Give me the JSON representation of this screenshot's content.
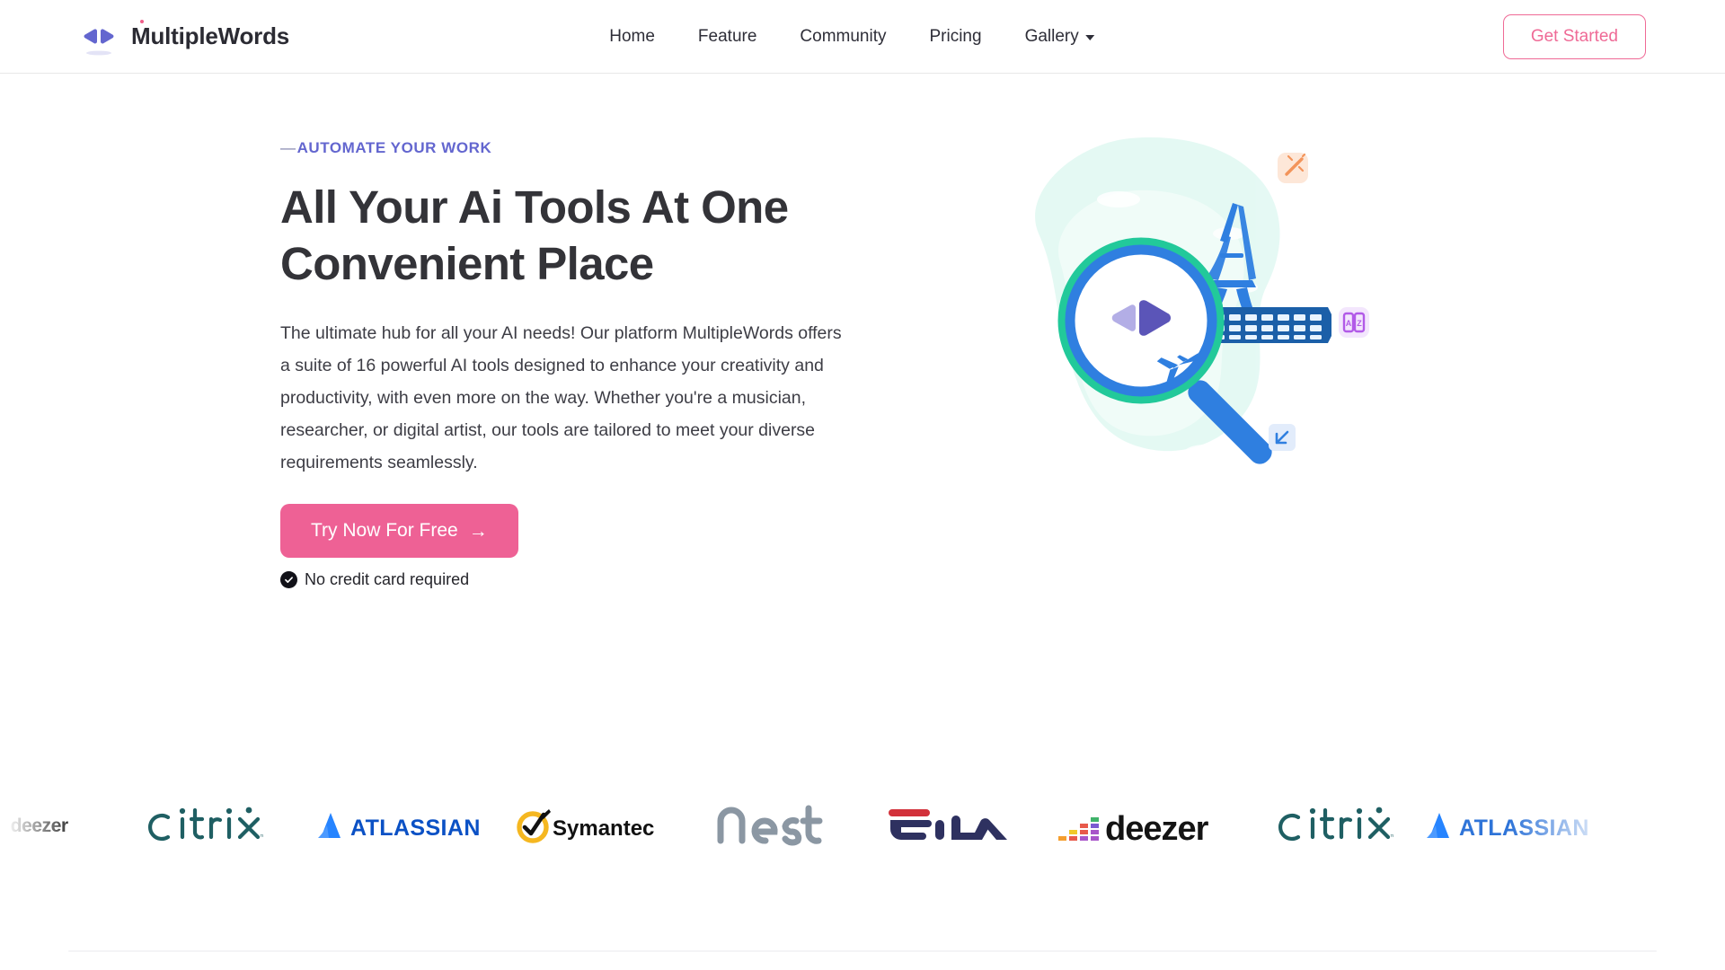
{
  "header": {
    "brand": {
      "name": "MultipleWords",
      "logo_icon": "bowtie-logo-icon",
      "color": "#6366cf"
    },
    "nav": [
      {
        "label": "Home",
        "has_dropdown": false
      },
      {
        "label": "Feature",
        "has_dropdown": false
      },
      {
        "label": "Community",
        "has_dropdown": false
      },
      {
        "label": "Pricing",
        "has_dropdown": false
      },
      {
        "label": "Gallery",
        "has_dropdown": true
      }
    ],
    "cta": {
      "label": "Get Started",
      "color": "#ef6a96"
    }
  },
  "hero": {
    "eyebrow_dash": "—",
    "eyebrow": "AUTOMATE YOUR WORK",
    "eyebrow_color": "#6366cf",
    "title": "All Your Ai Tools At One Convenient Place",
    "description": "The ultimate hub for all your AI needs! Our platform MultipleWords offers a suite of 16 powerful AI tools designed to enhance your creativity and productivity, with even more on the way. Whether you're a musician, researcher, or digital artist, our tools are tailored to meet your diverse requirements seamlessly.",
    "cta": {
      "label": "Try Now For Free",
      "arrow": "→",
      "color": "#ee6195"
    },
    "note": {
      "label": "No credit card required",
      "icon": "check-circle-icon"
    },
    "illustration": {
      "name": "magnifying-glass-travel-illustration",
      "lens_outer_color": "#22c99a",
      "lens_inner_color": "#2f7fe0",
      "blob_color": "#dcf7f0",
      "badges": [
        {
          "name": "magic-wand-badge",
          "bg": "#fde7d8",
          "fg": "#f3945a"
        },
        {
          "name": "translate-badge",
          "bg": "#f3e6fd",
          "fg": "#b25ae8"
        },
        {
          "name": "expand-badge",
          "bg": "#e2ecfb",
          "fg": "#2f7fe0"
        }
      ]
    }
  },
  "logos": [
    {
      "name": "deezer",
      "label": "deezer",
      "variant": "partial-left"
    },
    {
      "name": "citrix",
      "label": "citrix",
      "variant": "full"
    },
    {
      "name": "atlassian",
      "label": "ATLASSIAN",
      "variant": "full"
    },
    {
      "name": "symantec",
      "label": "Symantec",
      "variant": "full"
    },
    {
      "name": "nest",
      "label": "nest",
      "variant": "full"
    },
    {
      "name": "fila",
      "label": "FILA",
      "variant": "full"
    },
    {
      "name": "deezer",
      "label": "deezer",
      "variant": "full"
    },
    {
      "name": "citrix",
      "label": "citrix",
      "variant": "full"
    },
    {
      "name": "atlassian",
      "label": "ATLASSIAN",
      "variant": "partial-right"
    }
  ]
}
